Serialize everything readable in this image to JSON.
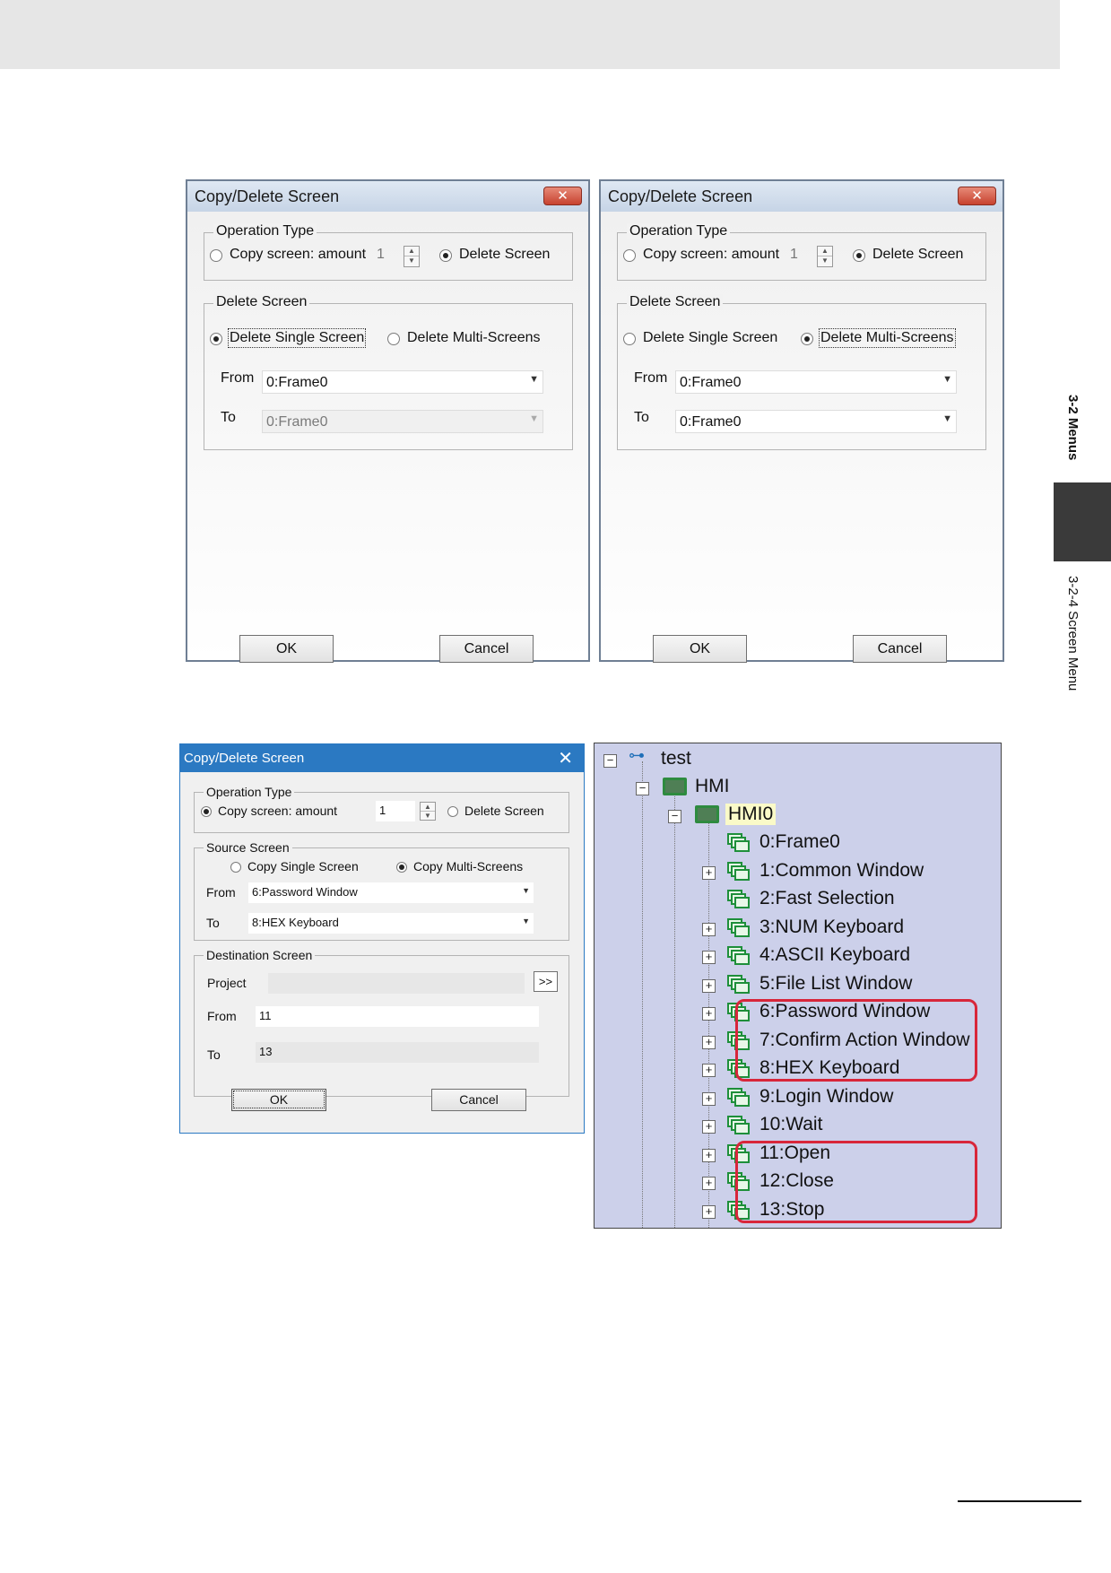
{
  "side": {
    "section": "3-2 Menus",
    "subsection": "3-2-4  Screen Menu"
  },
  "dialog_delete_single": {
    "title": "Copy/Delete Screen",
    "close": "✕",
    "op_group": "Operation Type",
    "copy_label": "Copy screen: amount",
    "amount": "1",
    "delete_label": "Delete Screen",
    "del_group": "Delete Screen",
    "single_label": "Delete Single Screen",
    "multi_label": "Delete Multi-Screens",
    "from_label": "From",
    "from_value": "0:Frame0",
    "to_label": "To",
    "to_value": "0:Frame0",
    "ok": "OK",
    "cancel": "Cancel"
  },
  "dialog_delete_multi": {
    "title": "Copy/Delete Screen",
    "close": "✕",
    "op_group": "Operation Type",
    "copy_label": "Copy screen: amount",
    "amount": "1",
    "delete_label": "Delete Screen",
    "del_group": "Delete Screen",
    "single_label": "Delete Single Screen",
    "multi_label": "Delete Multi-Screens",
    "from_label": "From",
    "from_value": "0:Frame0",
    "to_label": "To",
    "to_value": "0:Frame0",
    "ok": "OK",
    "cancel": "Cancel"
  },
  "dialog_copy": {
    "title": "Copy/Delete Screen",
    "close": "✕",
    "op_group": "Operation Type",
    "copy_label": "Copy screen: amount",
    "amount": "1",
    "delete_label": "Delete Screen",
    "src_group": "Source Screen",
    "single_label": "Copy Single Screen",
    "multi_label": "Copy Multi-Screens",
    "from_label": "From",
    "from_value": "6:Password Window",
    "to_label": "To",
    "to_value": "8:HEX Keyboard",
    "dst_group": "Destination Screen",
    "project_label": "Project",
    "browse": ">>",
    "dst_from_label": "From",
    "dst_from_value": "11",
    "dst_to_label": "To",
    "dst_to_value": "13",
    "ok": "OK",
    "cancel": "Cancel"
  },
  "tree": {
    "root": "test",
    "hmi": "HMI",
    "hmi0": "HMI0",
    "items": [
      "0:Frame0",
      "1:Common Window",
      "2:Fast Selection",
      "3:NUM Keyboard",
      "4:ASCII Keyboard",
      "5:File List Window",
      "6:Password Window",
      "7:Confirm Action Window",
      "8:HEX Keyboard",
      "9:Login Window",
      "10:Wait",
      "11:Open",
      "12:Close",
      "13:Stop"
    ],
    "highlight_color": "#d8263a"
  }
}
